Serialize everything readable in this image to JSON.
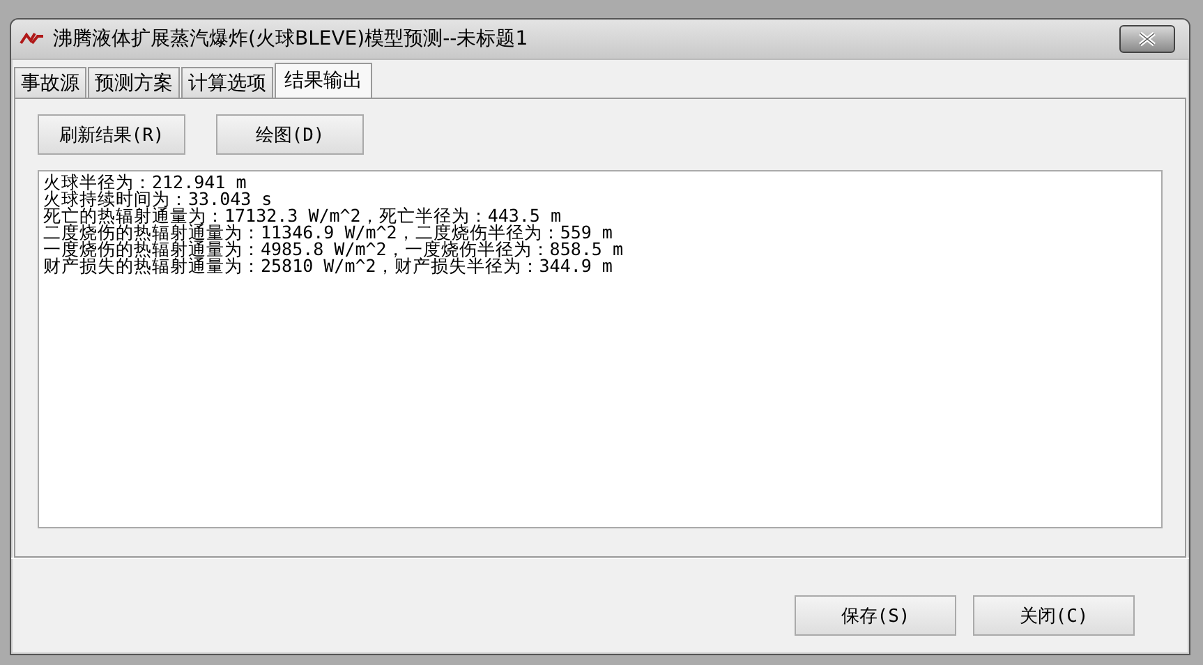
{
  "window": {
    "title": "沸腾液体扩展蒸汽爆炸(火球BLEVE)模型预测--未标题1"
  },
  "tabs": [
    {
      "label": "事故源",
      "selected": false
    },
    {
      "label": "预测方案",
      "selected": false
    },
    {
      "label": "计算选项",
      "selected": false
    },
    {
      "label": "结果输出",
      "selected": true
    }
  ],
  "toolbar_buttons": [
    "刷新结果(R)",
    "绘图(D)"
  ],
  "results": [
    "火球半径为：212.941 m",
    "火球持续时间为：33.043 s",
    "死亡的热辐射通量为：17132.3 W/m^2，死亡半径为：443.5 m",
    "二度烧伤的热辐射通量为：11346.9 W/m^2，二度烧伤半径为：559 m",
    "一度烧伤的热辐射通量为：4985.8 W/m^2，一度烧伤半径为：858.5 m",
    "财产损失的热辐射通量为：25810 W/m^2，财产损失半径为：344.9 m"
  ],
  "buttons": [
    "保存(S)",
    "关闭(C)"
  ]
}
